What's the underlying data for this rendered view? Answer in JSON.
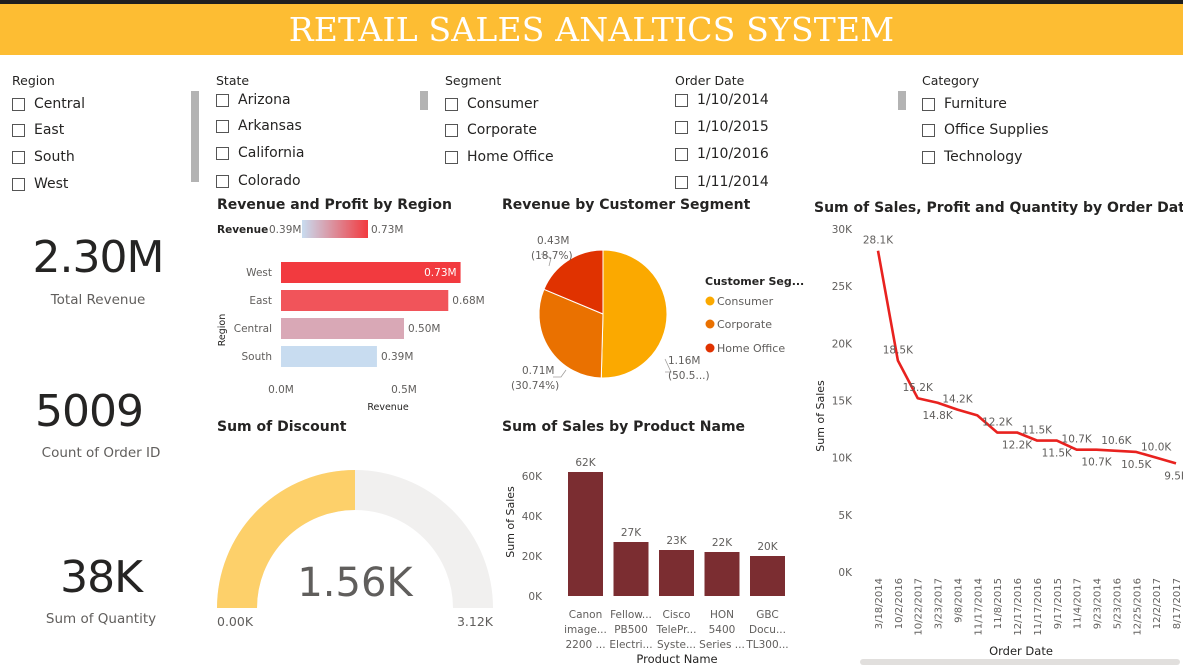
{
  "title": "RETAIL SALES ANALTICS SYSTEM",
  "slicers": {
    "region": {
      "title": "Region",
      "items": [
        "Central",
        "East",
        "South",
        "West"
      ]
    },
    "state": {
      "title": "State",
      "items": [
        "Arizona",
        "Arkansas",
        "California",
        "Colorado"
      ]
    },
    "segment": {
      "title": "Segment",
      "items": [
        "Consumer",
        "Corporate",
        "Home Office"
      ]
    },
    "order_date": {
      "title": "Order Date",
      "items": [
        "1/10/2014",
        "1/10/2015",
        "1/10/2016",
        "1/11/2014"
      ]
    },
    "category": {
      "title": "Category",
      "items": [
        "Furniture",
        "Office Supplies",
        "Technology"
      ]
    }
  },
  "kpis": [
    {
      "value": "2.30M",
      "label": "Total Revenue"
    },
    {
      "value": "5009",
      "label": "Count of Order ID"
    },
    {
      "value": "38K",
      "label": "Sum of Quantity"
    }
  ],
  "colors": {
    "banner": "#fdbd33",
    "consumer": "#fba900",
    "corporate": "#ea7100",
    "home_office": "#e03200",
    "product_bar": "#7b2d31",
    "line": "#e8221f",
    "gauge_fill": "#fdd06a",
    "gauge_track": "#f1f0ef"
  },
  "chart_data": [
    {
      "type": "bar",
      "title": "Revenue and Profit by Region",
      "orientation": "horizontal",
      "legend": {
        "label": "Revenue",
        "min": "0.39M",
        "max": "0.73M"
      },
      "categories": [
        "West",
        "East",
        "Central",
        "South"
      ],
      "values": [
        0.73,
        0.68,
        0.5,
        0.39
      ],
      "data_labels": [
        "0.73M",
        "0.68M",
        "0.50M",
        "0.39M"
      ],
      "bar_colors": [
        "#f23a3f",
        "#f1545a",
        "#d9a8b6",
        "#c8dcf0"
      ],
      "xlabel": "Revenue",
      "ylabel": "Region",
      "xticks": [
        "0.0M",
        "0.5M"
      ],
      "xlim": [
        0,
        0.8
      ]
    },
    {
      "type": "pie",
      "title": "Revenue by Customer Segment",
      "legend_title": "Customer Seg...",
      "categories": [
        "Consumer",
        "Corporate",
        "Home Office"
      ],
      "values": [
        1.16,
        0.71,
        0.43
      ],
      "percents": [
        50.5,
        30.74,
        18.7
      ],
      "data_labels": [
        {
          "value": "1.16M",
          "pct": "(50.5...)"
        },
        {
          "value": "0.71M",
          "pct": "(30.74%)"
        },
        {
          "value": "0.43M",
          "pct": "(18.7%)"
        }
      ]
    },
    {
      "type": "line",
      "title": "Sum of Sales, Profit and Quantity by Order Date",
      "xlabel": "Order Date",
      "ylabel": "Sum of Sales",
      "ylim": [
        0,
        30000
      ],
      "yticks": [
        "0K",
        "5K",
        "10K",
        "15K",
        "20K",
        "25K",
        "30K"
      ],
      "x": [
        "3/18/2014",
        "10/2/2016",
        "10/22/2017",
        "3/23/2017",
        "9/8/2014",
        "11/17/2014",
        "11/8/2015",
        "12/17/2016",
        "11/17/2016",
        "9/17/2015",
        "11/4/2017",
        "9/23/2014",
        "5/23/2016",
        "12/25/2016",
        "12/2/2017",
        "8/17/2017"
      ],
      "values": [
        28100,
        18500,
        15200,
        14800,
        14200,
        13700,
        12200,
        12200,
        11500,
        11500,
        10700,
        10700,
        10600,
        10500,
        10000,
        9500
      ],
      "data_labels": [
        "28.1K",
        "18.5K",
        "15.2K",
        "14.8K",
        "14.2K",
        "",
        "12.2K",
        "12.2K",
        "11.5K",
        "11.5K",
        "10.7K",
        "10.7K",
        "10.6K",
        "10.5K",
        "10.0K",
        "9.5K"
      ]
    },
    {
      "type": "gauge",
      "title": "Sum of Discount",
      "value": 1.56,
      "value_label": "1.56K",
      "min_label": "0.00K",
      "max_label": "3.12K",
      "min": 0,
      "max": 3.12
    },
    {
      "type": "bar",
      "title": "Sum of Sales by Product Name",
      "xlabel": "Product Name",
      "ylabel": "Sum of Sales",
      "ylim": [
        0,
        70000
      ],
      "yticks": [
        "0K",
        "20K",
        "40K",
        "60K"
      ],
      "categories": [
        [
          "Canon",
          "image...",
          "2200 ..."
        ],
        [
          "Fellow...",
          "PB500",
          "Electri..."
        ],
        [
          "Cisco",
          "TelePr...",
          "Syste..."
        ],
        [
          "HON",
          "5400",
          "Series ..."
        ],
        [
          "GBC",
          "Docu...",
          "TL300..."
        ]
      ],
      "values": [
        62000,
        27000,
        23000,
        22000,
        20000
      ],
      "data_labels": [
        "62K",
        "27K",
        "23K",
        "22K",
        "20K"
      ]
    }
  ]
}
